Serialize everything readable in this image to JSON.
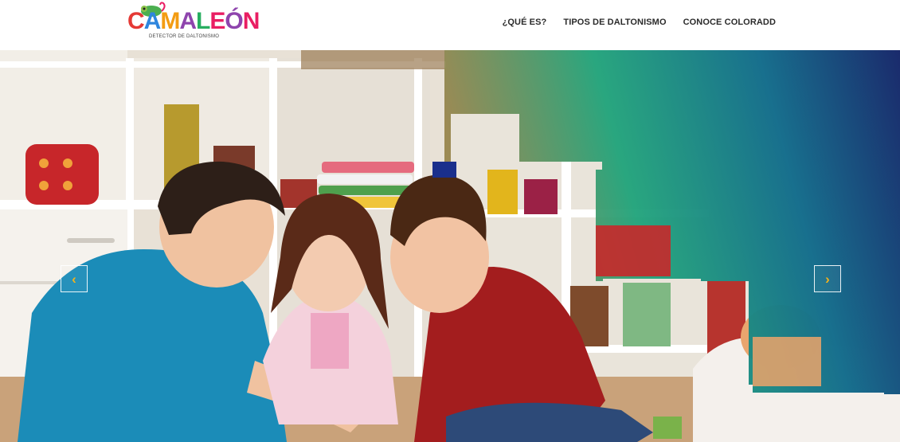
{
  "brand": {
    "logo_letters": [
      "C",
      "A",
      "M",
      "A",
      "L",
      "E",
      "Ó",
      "N"
    ],
    "logo_colors": [
      "#e53935",
      "#2e86de",
      "#f39c12",
      "#8e44ad",
      "#27ae60",
      "#e91e63",
      "#8e44ad",
      "#e91e63"
    ],
    "tagline": "DETECTOR DE DALTONISMO"
  },
  "nav": {
    "items": [
      {
        "label": "¿QUÉ ES?"
      },
      {
        "label": "TIPOS DE DALTONISMO"
      },
      {
        "label": "CONOCE COLORADD"
      }
    ]
  },
  "slider": {
    "prev_icon": "chevron-left-icon",
    "next_icon": "chevron-right-icon",
    "prev_glyph": "‹",
    "next_glyph": "›",
    "arrow_color": "#f3b21b"
  },
  "colors": {
    "overlay_green": "#1fa37a",
    "overlay_blue": "#1a2a6c"
  }
}
